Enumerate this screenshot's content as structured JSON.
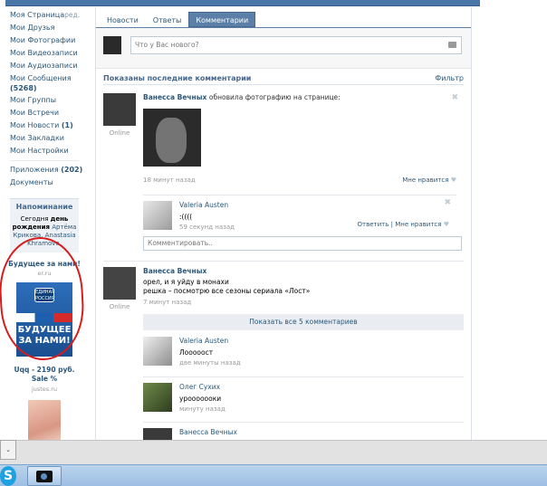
{
  "sidebar": {
    "edit_label": "ред.",
    "items": [
      {
        "label": "Моя Страница"
      },
      {
        "label": "Мои Друзья"
      },
      {
        "label": "Мои Фотографии"
      },
      {
        "label": "Мои Видеозаписи"
      },
      {
        "label": "Мои Аудиозаписи"
      },
      {
        "label": "Мои Сообщения",
        "count": "(5268)"
      },
      {
        "label": "Мои Группы"
      },
      {
        "label": "Мои Встречи"
      },
      {
        "label": "Мои Новости",
        "count": "(1)"
      },
      {
        "label": "Мои Закладки"
      },
      {
        "label": "Мои Настройки"
      },
      {
        "label": "Приложения",
        "count": "(202)"
      },
      {
        "label": "Документы"
      }
    ]
  },
  "reminder": {
    "title": "Напоминание",
    "line1": "Сегодня",
    "bold": "день рождения",
    "names": "Артёма Крикова, Anastasia Khramova."
  },
  "ads": [
    {
      "title": "Будущее за нами!",
      "site": "er.ru",
      "logo": "ЕДИНАЯ РОССИЯ",
      "banner": "БУДУЩЕЕ ЗА НАМИ!"
    },
    {
      "title": "Uqq - 2190 руб. Sale %",
      "site": "justes.ru"
    }
  ],
  "tabs": [
    "Новости",
    "Ответы",
    "Комментарии"
  ],
  "composer": {
    "placeholder": "Что у Вас нового?"
  },
  "feed": {
    "heading": "Показаны последние комментарии",
    "filter": "Фильтр"
  },
  "post1": {
    "author": "Ванесса Вечных",
    "action": "обновила фотографию на странице:",
    "online": "Online",
    "time": "18 минут назад",
    "like": "Мне нравится",
    "reply": {
      "name": "Valeria Austen",
      "text": ":((((",
      "time": "59 секунд назад",
      "answer": "Ответить",
      "like": "Мне нравится"
    },
    "comment_placeholder": "Комментировать.."
  },
  "post2": {
    "author": "Ванесса Вечных",
    "line1": "орел, и я уйду в монахи",
    "line2": "решка – посмотрю все сезоны сериала «Лост»",
    "online": "Online",
    "time": "7 минут назад",
    "show_all": "Показать все 5 комментариев",
    "replies": [
      {
        "name": "Valeria Austen",
        "text": "Лооооост",
        "time": "две минуты назад"
      },
      {
        "name": "Олег Сухих",
        "text": "урооооооки",
        "time": "минуту назад"
      },
      {
        "name": "Ванесса Вечных"
      }
    ]
  },
  "taskbar": {
    "skype": "S"
  }
}
